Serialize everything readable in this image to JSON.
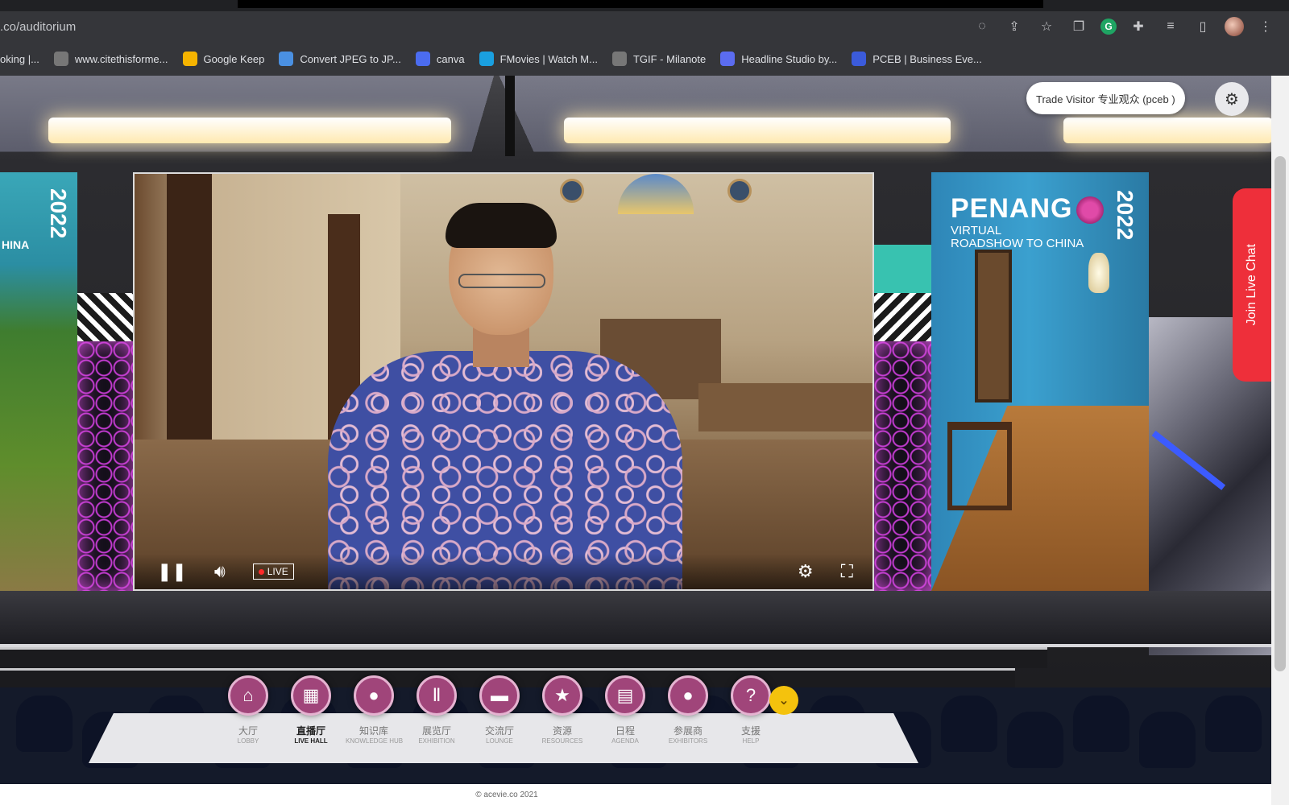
{
  "browser": {
    "url": ".co/auditorium",
    "bookmarks": [
      {
        "label": "oking |...",
        "icon": "page-icon"
      },
      {
        "label": "www.citethisforme...",
        "icon": "globe-icon"
      },
      {
        "label": "Google Keep",
        "icon": "keep-icon"
      },
      {
        "label": "Convert JPEG to JP...",
        "icon": "convert-icon"
      },
      {
        "label": "canva",
        "icon": "canva-icon"
      },
      {
        "label": "FMovies | Watch M...",
        "icon": "play-icon"
      },
      {
        "label": "TGIF - Milanote",
        "icon": "milanote-icon"
      },
      {
        "label": "Headline Studio by...",
        "icon": "headline-icon"
      },
      {
        "label": "PCEB | Business Eve...",
        "icon": "pceb-icon"
      }
    ]
  },
  "banner_left": {
    "year": "2022",
    "sub": "HINA"
  },
  "banner_right": {
    "title": "PENANG",
    "sub1": "VIRTUAL",
    "sub2": "ROADSHOW TO CHINA",
    "year": "2022"
  },
  "player": {
    "live_label": "LIVE"
  },
  "user": {
    "label": "Trade Visitor 专业观众 (pceb )"
  },
  "chat": {
    "label": "Join Live Chat"
  },
  "nav": [
    {
      "cn": "大厅",
      "en": "LOBBY",
      "icon": "home-icon",
      "glyph": "⌂"
    },
    {
      "cn": "直播厅",
      "en": "LIVE HALL",
      "icon": "live-hall-icon",
      "glyph": "▦"
    },
    {
      "cn": "知识库",
      "en": "KNOWLEDGE HUB",
      "icon": "bulb-icon",
      "glyph": "●"
    },
    {
      "cn": "展览厅",
      "en": "EXHIBITION",
      "icon": "exhibition-icon",
      "glyph": "Ⅱ"
    },
    {
      "cn": "交流厅",
      "en": "LOUNGE",
      "icon": "lounge-icon",
      "glyph": "▬"
    },
    {
      "cn": "资源",
      "en": "RESOURCES",
      "icon": "star-icon",
      "glyph": "★"
    },
    {
      "cn": "日程",
      "en": "AGENDA",
      "icon": "clipboard-icon",
      "glyph": "▤"
    },
    {
      "cn": "参展商",
      "en": "EXHIBITORS",
      "icon": "person-icon",
      "glyph": "●"
    },
    {
      "cn": "支援",
      "en": "HELP",
      "icon": "help-icon",
      "glyph": "?"
    }
  ],
  "active_nav": "LIVE HALL",
  "footer": {
    "copyright": "© acevie.co 2021"
  },
  "colors": {
    "nav_circle": "#a0457a",
    "chat": "#ee2f3a",
    "more_button": "#f4c20d"
  }
}
